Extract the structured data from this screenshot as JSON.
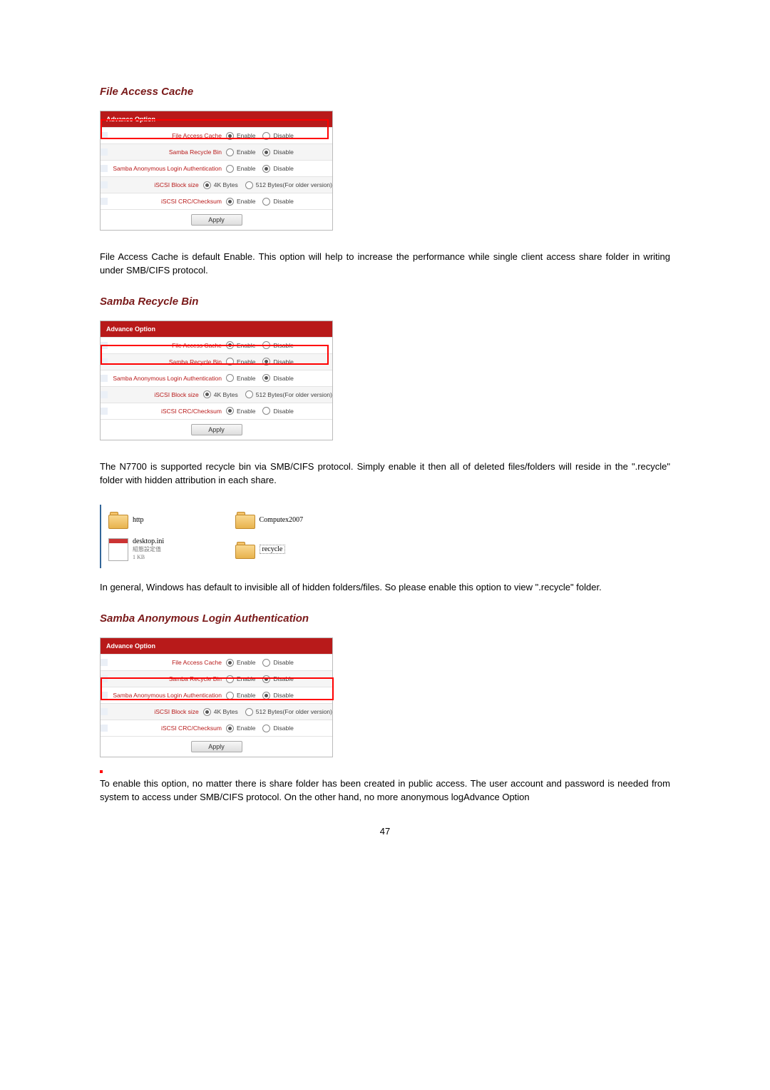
{
  "pageNumber": "47",
  "sections": {
    "s1": {
      "title": "File Access Cache",
      "text": "File Access Cache is default Enable. This option will help to increase the performance while single client access share folder in writing under SMB/CIFS protocol."
    },
    "s2": {
      "title": "Samba Recycle Bin",
      "text1": "The N7700 is supported recycle bin via SMB/CIFS protocol. Simply enable it then all of deleted files/folders will reside in the \".recycle\" folder with hidden attribution in each share.",
      "text2": "In general, Windows has default to invisible all of hidden folders/files. So please enable this option to view \".recycle\" folder."
    },
    "s3": {
      "title": "Samba Anonymous Login Authentication",
      "text": "To enable this option, no matter there is share folder has been created in public access. The user account and password is needed from system to access under SMB/CIFS protocol. On the other hand, no more anonymous logAdvance Option"
    }
  },
  "panel": {
    "header": "Advance Option",
    "apply": "Apply",
    "rows": {
      "fac": {
        "label": "File Access Cache",
        "opt1": "Enable",
        "opt2": "Disable"
      },
      "srb": {
        "label": "Samba Recycle Bin",
        "opt1": "Enable",
        "opt2": "Disable"
      },
      "sala": {
        "label": "Samba Anonymous Login Authentication",
        "opt1": "Enable",
        "opt2": "Disable"
      },
      "iscsiB": {
        "label": "iSCSI Block size",
        "opt1": "4K Bytes",
        "opt2": "512 Bytes(For older version)"
      },
      "iscsiC": {
        "label": "iSCSI CRC/Checksum",
        "opt1": "Enable",
        "opt2": "Disable"
      }
    }
  },
  "folders": {
    "http": "http",
    "computex": "Computex2007",
    "ini_name": "desktop.ini",
    "ini_desc": "組態設定值",
    "ini_size": "1 KB",
    "recycle": "recycle"
  }
}
